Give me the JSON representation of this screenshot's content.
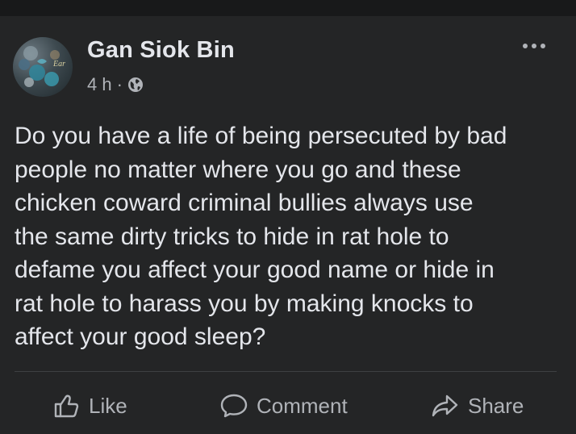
{
  "post": {
    "author": "Gan Siok Bin",
    "time": "4 h",
    "separator": "·",
    "audience_icon": "globe-icon",
    "more_icon": "more-horizontal-icon",
    "avatar_text": "Ear",
    "body": "Do you have a life of being persecuted by bad\npeople no matter where you go and these\nchicken coward criminal bullies always use\nthe same dirty tricks to hide in rat hole to\ndefame you affect your good name or hide in\nrat hole to harass you by making knocks to\naffect your good sleep?"
  },
  "actions": {
    "like": {
      "label": "Like",
      "icon": "thumbs-up-icon"
    },
    "comment": {
      "label": "Comment",
      "icon": "comment-icon"
    },
    "share": {
      "label": "Share",
      "icon": "share-icon"
    }
  },
  "colors": {
    "background": "#242526",
    "top_bar": "#18191a",
    "primary_text": "#e4e6eb",
    "secondary_text": "#b0b3b8",
    "divider": "#3e4042"
  }
}
